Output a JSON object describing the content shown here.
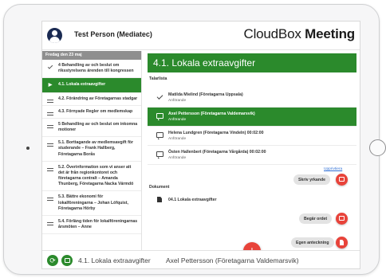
{
  "header": {
    "user_name": "Test Person (Mediatec)",
    "brand_light": "CloudBox",
    "brand_bold": "Meeting"
  },
  "sidebar": {
    "date_header": "Fredag den 23 maj",
    "items": [
      {
        "label": "4 Behandling av och beslut om riksstyrelsens ärenden till kongressen",
        "icon": "check-icon",
        "active": false
      },
      {
        "label": "4.1. Lokala extraavgifter",
        "icon": "play-icon",
        "active": true
      },
      {
        "label": "4.2. Förändring av Företagarnas stadgar",
        "icon": "equal-icon",
        "active": false
      },
      {
        "label": "4.3. Förnyade Regler om medlemskap",
        "icon": "equal-icon",
        "active": false
      },
      {
        "label": "5 Behandling av och beslut om inkomna motioner",
        "icon": "equal-icon",
        "active": false
      },
      {
        "label": "5.1. Borttagande av medlemsavgift för studerande – Frank Hallberg, Företagarna Borås",
        "icon": "equal-icon",
        "active": false
      },
      {
        "label": "5.2. Överinformation som vi anser att det är från regionkontoret och företagarna centralt – Amanda Thunberg, Företagarna Nacka Värmdö",
        "icon": "equal-icon",
        "active": false
      },
      {
        "label": "5.3. Bättre ekonomi för lokalföreningarna – Johan Löfquist, Företagarna Hörby",
        "icon": "equal-icon",
        "active": false
      },
      {
        "label": "5.4. Förläng tiden för lokalföreningarnas årsmöten – Anne",
        "icon": "equal-icon",
        "active": false
      }
    ]
  },
  "main": {
    "title": "4.1. Lokala extraavgifter",
    "speakers_label": "Talarlista",
    "speakers": [
      {
        "name": "Matilda Mielind (Företagarna Uppsala)",
        "status": "Anförande",
        "icon": "check-icon",
        "active": false
      },
      {
        "name": "Axel Pettersson (Företagarna Valdemarsvik)",
        "status": "Anförande",
        "icon": "speech-bubble-icon",
        "active": true
      },
      {
        "name": "Helena Lundgren (Företagarna Vindeln) 00:02:00",
        "status": "Anförande",
        "icon": "speech-bubble-icon",
        "active": false
      },
      {
        "name": "Östen Hallenbert (Företagarna Vårgårda) 00:02:00",
        "status": "Anförande",
        "icon": "speech-bubble-icon",
        "active": false
      }
    ],
    "documents_label": "Dokument",
    "documents": [
      {
        "name": "04.1 Lokala extraavgifter",
        "icon": "document-icon"
      }
    ],
    "undo_label": "Upprivtiera",
    "actions": [
      {
        "label": "Skriv yrkande",
        "icon": "speech-bubble-icon"
      },
      {
        "label": "Begär ordet",
        "icon": "speech-bubble-icon"
      },
      {
        "label": "Egen anteckning",
        "icon": "document-icon"
      }
    ],
    "fab_label": "+"
  },
  "footer": {
    "current_item": "4.1. Lokala extraavgifter",
    "current_speaker": "Axel Pettersson (Företagarna Valdemarsvik)",
    "refresh_symbol": "⟳"
  },
  "colors": {
    "accent_green": "#2b8a2c",
    "action_red": "#e8433a",
    "date_header_gray": "#8f8f8f",
    "link_blue": "#2f6fd6"
  }
}
